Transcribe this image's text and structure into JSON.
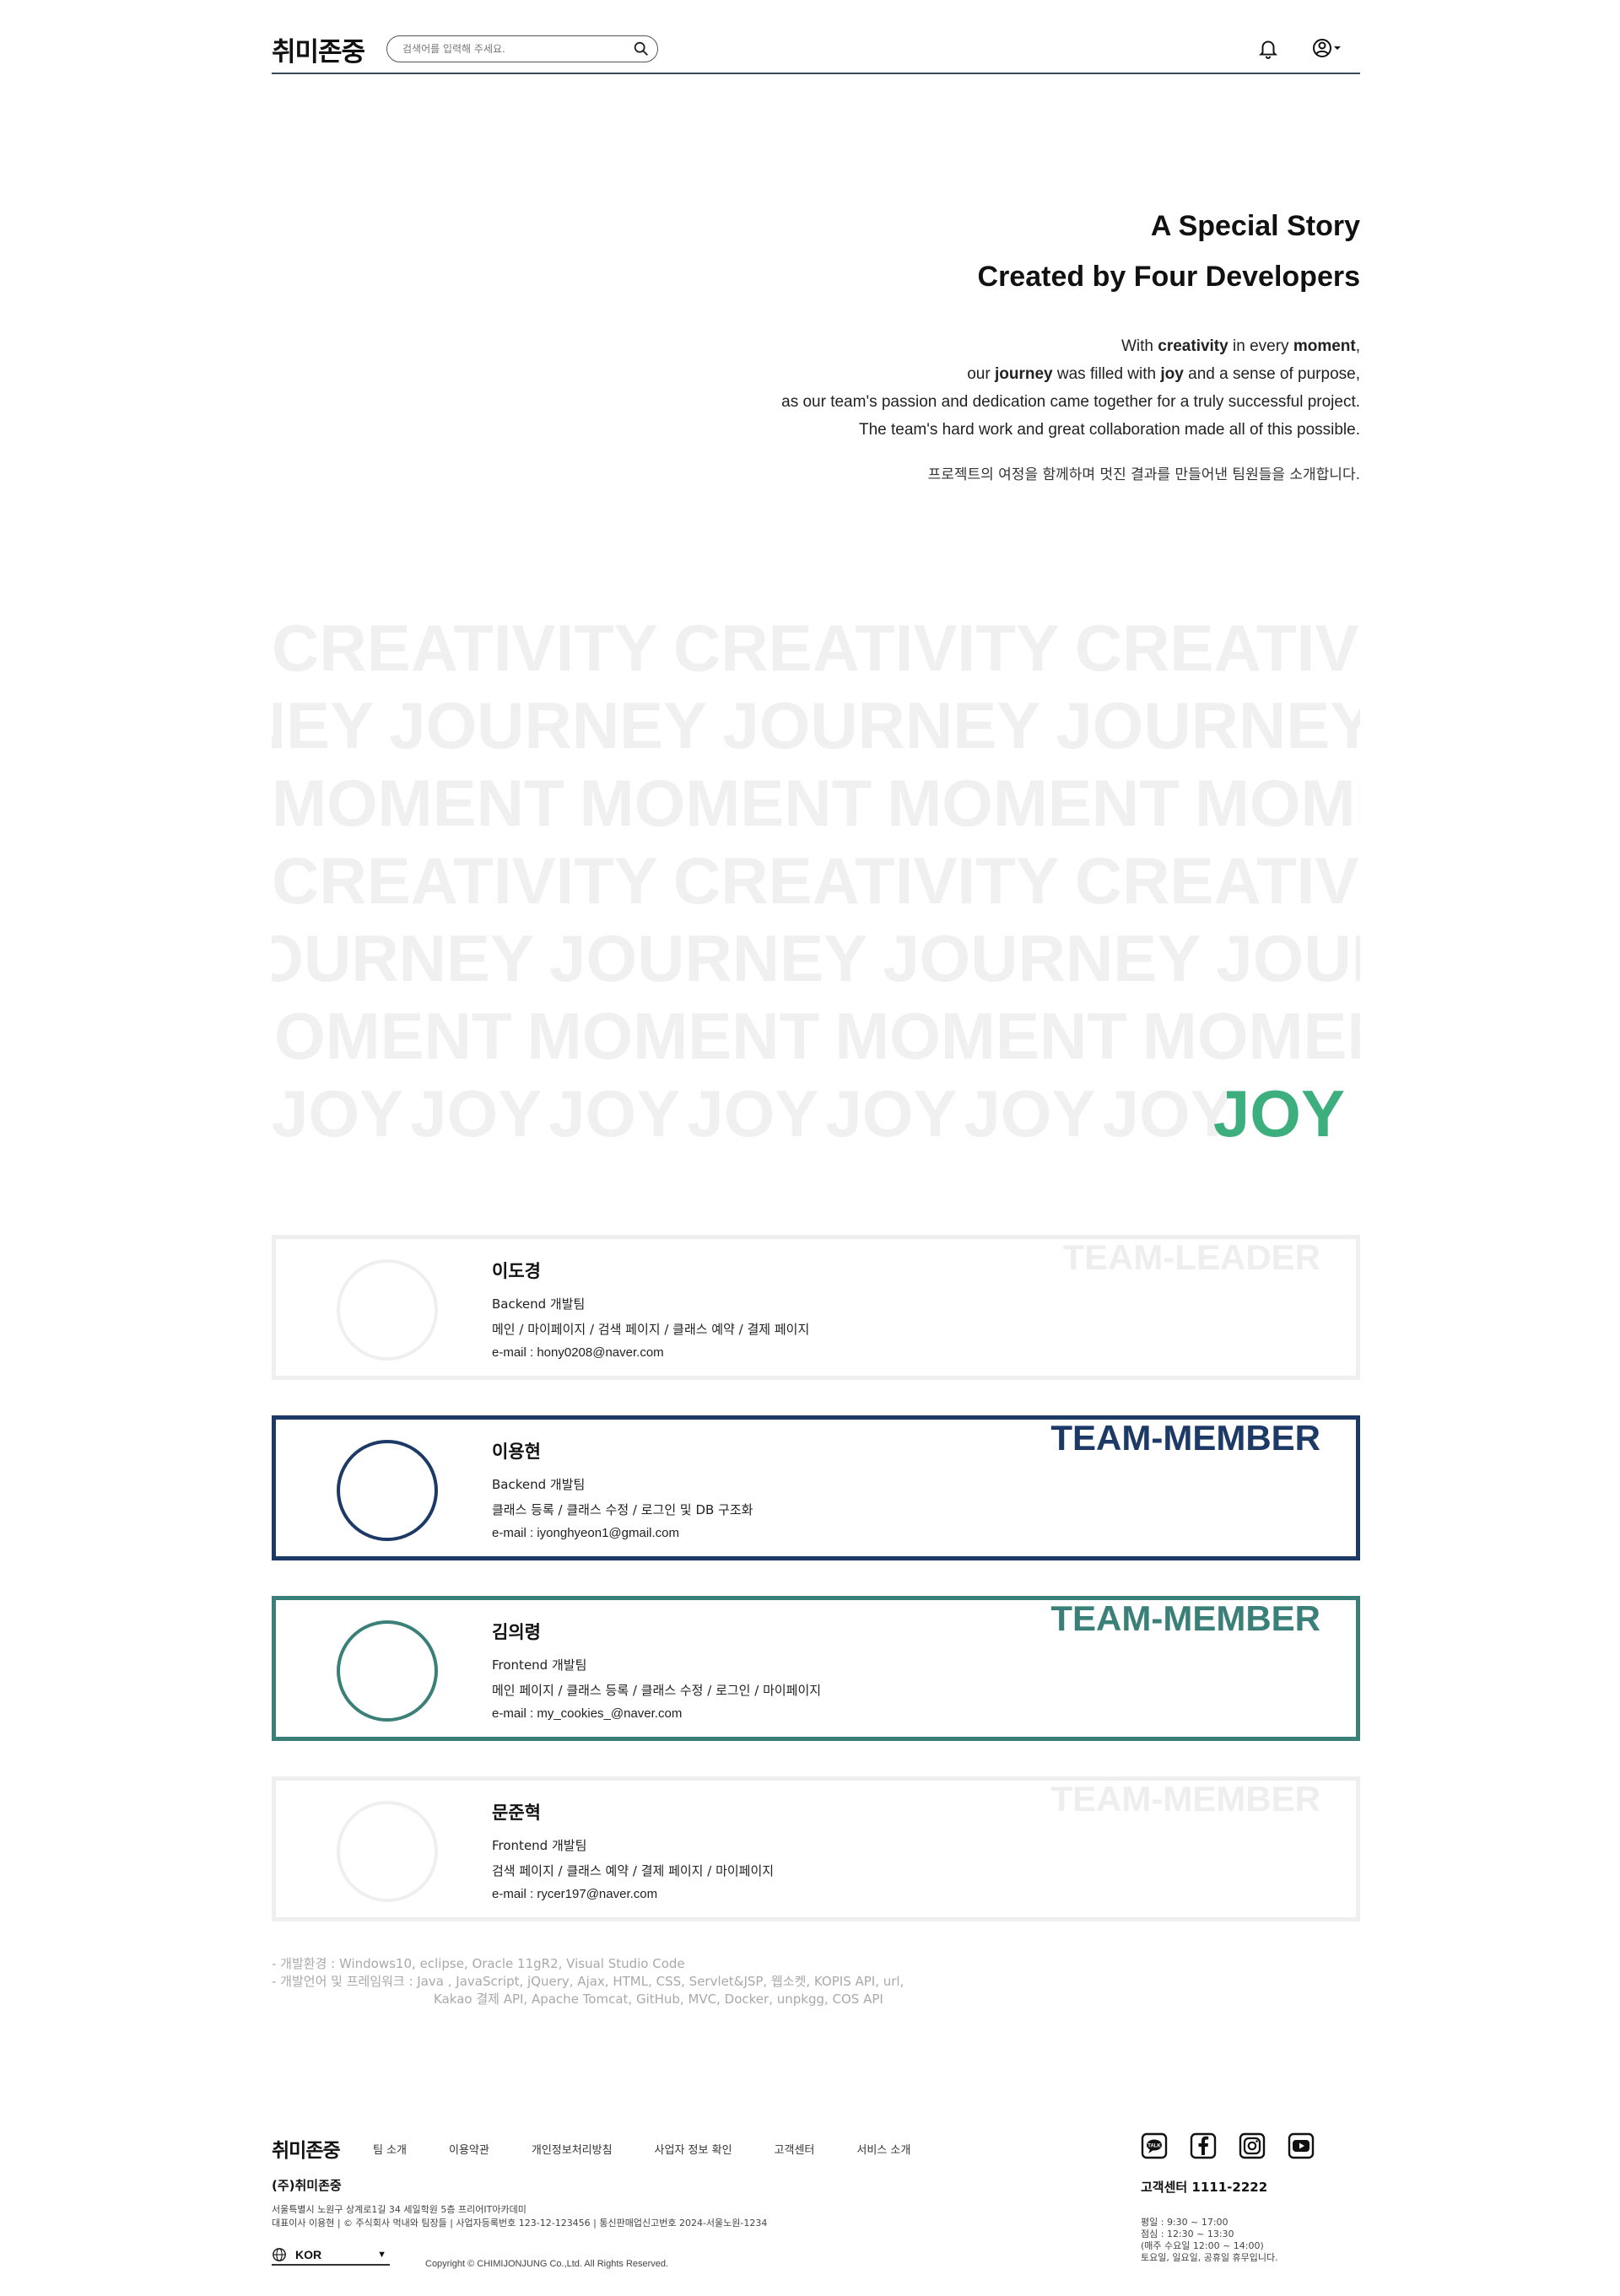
{
  "header": {
    "logo": "취미존중",
    "search_placeholder": "검색어를 입력해 주세요."
  },
  "intro": {
    "title_line1": "A Special Story",
    "title_line2": "Created by Four Developers",
    "p1_pre": "With ",
    "p1_b1": "creativity",
    "p1_mid": " in every ",
    "p1_b2": "moment",
    "p1_post": ",",
    "p2_pre": "our ",
    "p2_b1": "journey",
    "p2_mid": " was filled with ",
    "p2_b2": "joy",
    "p2_post": " and a sense of purpose,",
    "p3": "as our team's passion and dedication came together for a truly successful project.",
    "p4": "The team's hard work and great collaboration made all of this possible.",
    "korean": "프로젝트의 여정을 함께하며 멋진 결과를 만들어낸 팀원들을 소개합니다."
  },
  "words": {
    "creativity": "CREATIVITY",
    "journey": "JOURNEY",
    "moment": "MOMENT",
    "joy": "JOY"
  },
  "team": [
    {
      "role": "TEAM-LEADER",
      "name": "이도경",
      "team": "Backend 개발팀",
      "pages": "메인 / 마이페이지 / 검색 페이지 / 클래스 예약 / 결제 페이지",
      "email": "e-mail : hony0208@naver.com"
    },
    {
      "role": "TEAM-MEMBER",
      "name": "이용현",
      "team": "Backend 개발팀",
      "pages": "클래스 등록 / 클래스 수정 / 로그인 및 DB 구조화",
      "email": "e-mail : iyonghyeon1@gmail.com"
    },
    {
      "role": "TEAM-MEMBER",
      "name": "김의령",
      "team": "Frontend 개발팀",
      "pages": "메인 페이지 / 클래스 등록 / 클래스 수정 / 로그인 / 마이페이지",
      "email": "e-mail : my_cookies_@naver.com"
    },
    {
      "role": "TEAM-MEMBER",
      "name": "문준혁",
      "team": "Frontend 개발팀",
      "pages": "검색 페이지 / 클래스 예약 / 결제 페이지 / 마이페이지",
      "email": "e-mail : rycer197@naver.com"
    }
  ],
  "dev": {
    "env": "- 개발환경 : Windows10, eclipse, Oracle 11gR2, Visual Studio Code",
    "lang1": "- 개발언어 및 프레임워크 : Java , JavaScript, jQuery, Ajax, HTML, CSS, Servlet&JSP, 웹소켓, KOPIS API, url,",
    "lang2": "Kakao 결제 API, Apache Tomcat, GitHub, MVC, Docker, unpkgg, COS API"
  },
  "footer": {
    "logo": "취미존중",
    "nav": [
      "팀 소개",
      "이용약관",
      "개인정보처리방침",
      "사업자 정보 확인",
      "고객센터",
      "서비스 소개"
    ],
    "company": "(주)취미존중",
    "addr1": "서울특별시 노원구 상계로1길 34 세일학원 5층 프리어IT아카데미",
    "addr2": "대표이사 이용현 | © 주식회사 먹내와 팀장들 | 사업자등록번호 123-12-123456 | 통신판매업신고번호 2024-서울노원-1234",
    "lang": "KOR",
    "copyright": "Copyright © CHIMIJONJUNG Co.,Ltd. All Rights Reserved.",
    "cs": "고객센터 1111-2222",
    "hours1": "평일 : 9:30 ~ 17:00",
    "hours2": "점심 : 12:30 ~ 13:30",
    "hours3": "(매주 수요일 12:00 ~ 14:00)",
    "hours4": "토요일, 일요일, 공휴일 휴무입니다."
  },
  "colors": {
    "accent_green": "#3dae7e",
    "navy": "#1d3a66",
    "teal": "#3a7f78"
  }
}
